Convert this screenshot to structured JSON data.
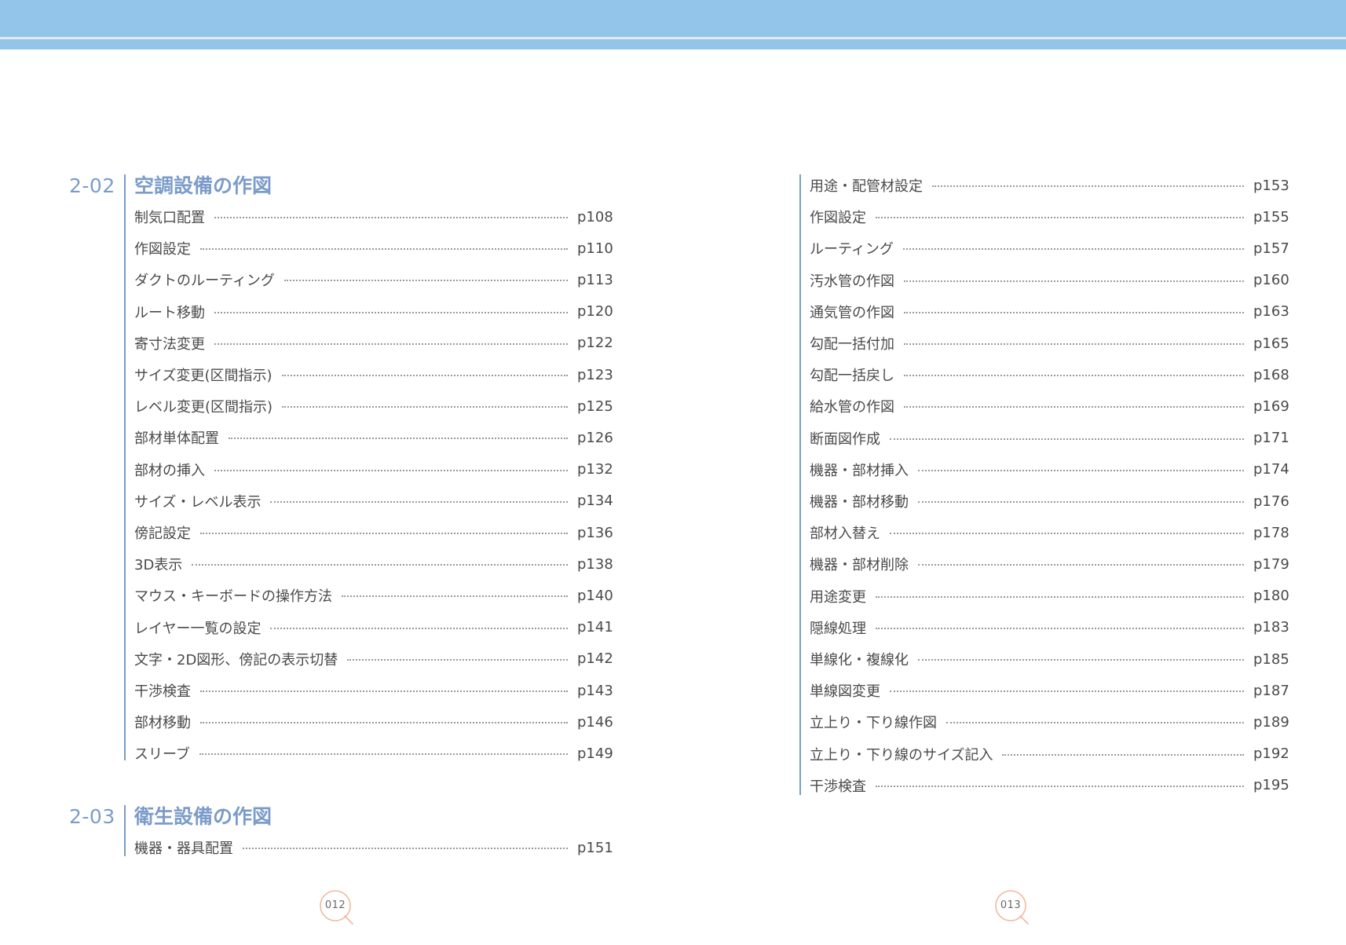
{
  "sections": [
    {
      "number": "2-02",
      "title": "空調設備の作図",
      "items": [
        {
          "label": "制気口配置",
          "page": "p108"
        },
        {
          "label": "作図設定",
          "page": "p110"
        },
        {
          "label": "ダクトのルーティング",
          "page": "p113"
        },
        {
          "label": "ルート移動",
          "page": "p120"
        },
        {
          "label": "寄寸法変更",
          "page": "p122"
        },
        {
          "label": "サイズ変更(区間指示)",
          "page": "p123"
        },
        {
          "label": "レベル変更(区間指示)",
          "page": "p125"
        },
        {
          "label": "部材単体配置",
          "page": "p126"
        },
        {
          "label": "部材の挿入",
          "page": "p132"
        },
        {
          "label": "サイズ・レベル表示",
          "page": "p134"
        },
        {
          "label": "傍記設定",
          "page": "p136"
        },
        {
          "label": "3D表示",
          "page": "p138"
        },
        {
          "label": "マウス・キーボードの操作方法",
          "page": "p140"
        },
        {
          "label": "レイヤー一覧の設定",
          "page": "p141"
        },
        {
          "label": "文字・2D図形、傍記の表示切替",
          "page": "p142"
        },
        {
          "label": "干渉検査",
          "page": "p143"
        },
        {
          "label": "部材移動",
          "page": "p146"
        },
        {
          "label": "スリーブ",
          "page": "p149"
        }
      ]
    },
    {
      "number": "2-03",
      "title": "衛生設備の作図",
      "items": [
        {
          "label": "機器・器具配置",
          "page": "p151"
        }
      ]
    }
  ],
  "continued_items": [
    {
      "label": "用途・配管材設定",
      "page": "p153"
    },
    {
      "label": "作図設定",
      "page": "p155"
    },
    {
      "label": "ルーティング",
      "page": "p157"
    },
    {
      "label": "汚水管の作図",
      "page": "p160"
    },
    {
      "label": "通気管の作図",
      "page": "p163"
    },
    {
      "label": "勾配一括付加",
      "page": "p165"
    },
    {
      "label": "勾配一括戻し",
      "page": "p168"
    },
    {
      "label": "給水管の作図",
      "page": "p169"
    },
    {
      "label": "断面図作成",
      "page": "p171"
    },
    {
      "label": "機器・部材挿入",
      "page": "p174"
    },
    {
      "label": "機器・部材移動",
      "page": "p176"
    },
    {
      "label": "部材入替え",
      "page": "p178"
    },
    {
      "label": "機器・部材削除",
      "page": "p179"
    },
    {
      "label": "用途変更",
      "page": "p180"
    },
    {
      "label": "隠線処理",
      "page": "p183"
    },
    {
      "label": "単線化・複線化",
      "page": "p185"
    },
    {
      "label": "単線図変更",
      "page": "p187"
    },
    {
      "label": "立上り・下り線作図",
      "page": "p189"
    },
    {
      "label": "立上り・下り線のサイズ記入",
      "page": "p192"
    },
    {
      "label": "干渉検査",
      "page": "p195"
    }
  ],
  "page_numbers": {
    "left": "012",
    "right": "013"
  },
  "colors": {
    "band": "#93c5ea",
    "heading": "#7b9cca",
    "page_badge": "#f0b9a0"
  }
}
